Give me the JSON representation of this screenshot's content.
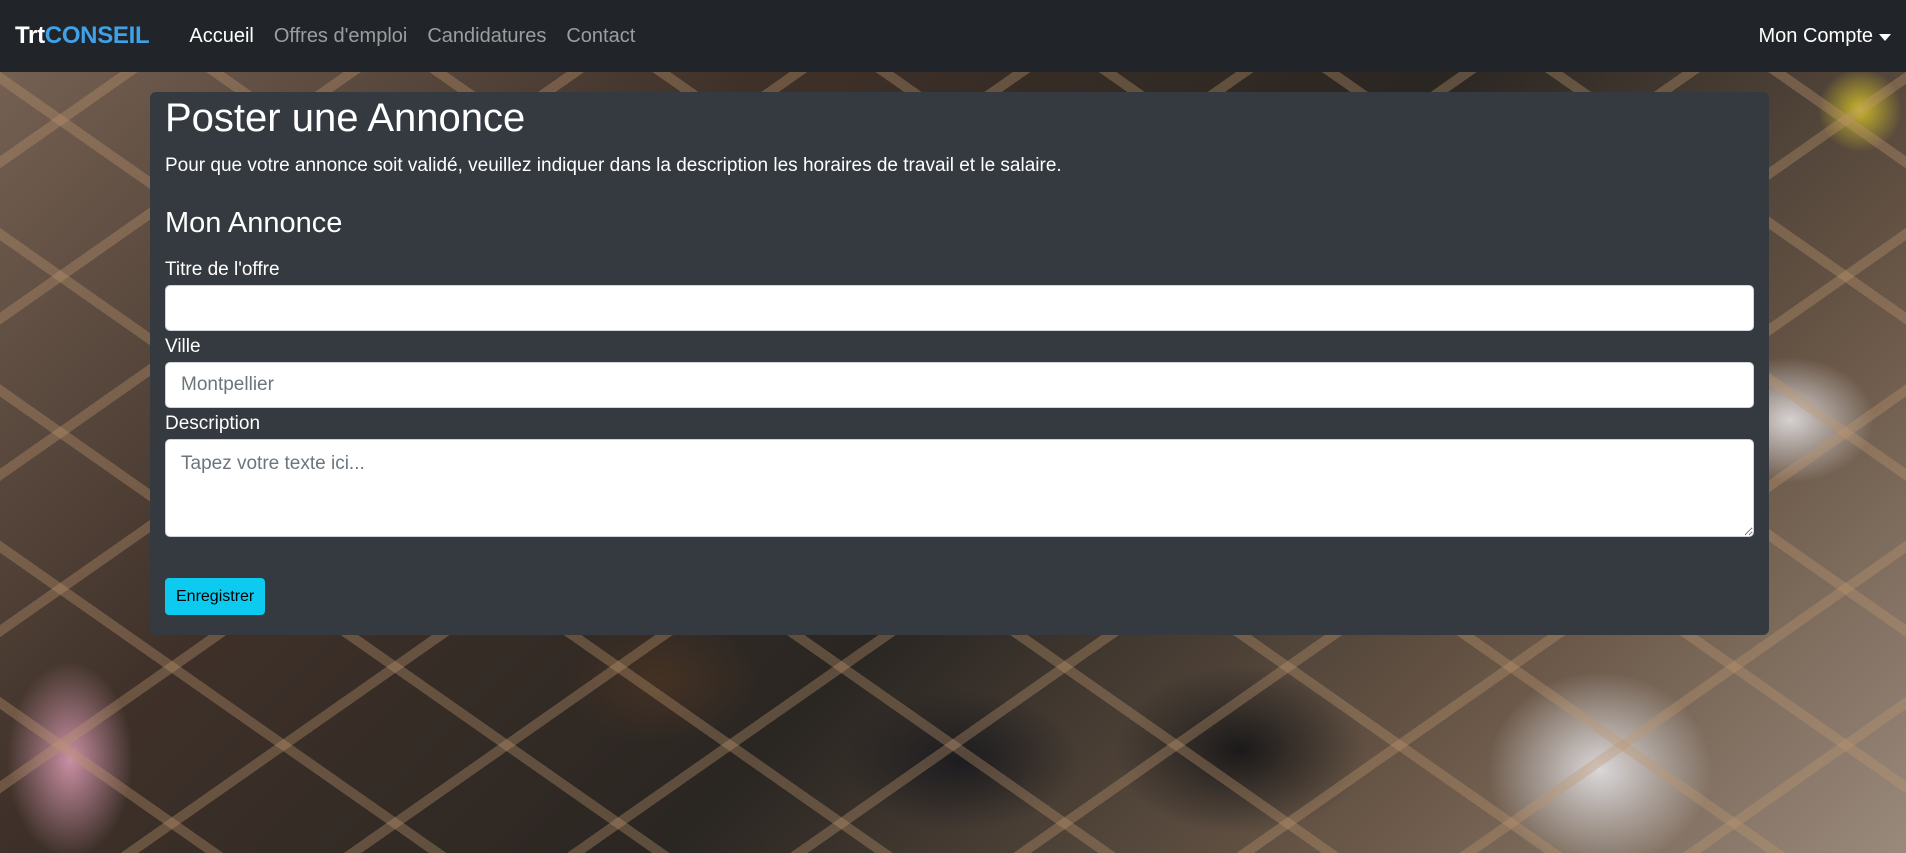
{
  "navbar": {
    "brand_part1": "Trt",
    "brand_part2": "CONSEIL",
    "links": [
      {
        "label": "Accueil",
        "active": true
      },
      {
        "label": "Offres d'emploi",
        "active": false
      },
      {
        "label": "Candidatures",
        "active": false
      },
      {
        "label": "Contact",
        "active": false
      }
    ],
    "account_label": "Mon Compte"
  },
  "form": {
    "page_title": "Poster une Annonce",
    "intro": "Pour que votre annonce soit validé, veuillez indiquer dans la description les horaires de travail et le salaire.",
    "section_title": "Mon Annonce",
    "title_label": "Titre de l'offre",
    "title_value": "",
    "city_label": "Ville",
    "city_placeholder": "Montpellier",
    "description_label": "Description",
    "description_placeholder": "Tapez votre texte ici...",
    "submit_label": "Enregistrer"
  },
  "colors": {
    "navbar_bg": "#212529",
    "card_bg": "#343a40",
    "brand_accent": "#3fa1e8",
    "button_bg": "#0dcaf0"
  }
}
